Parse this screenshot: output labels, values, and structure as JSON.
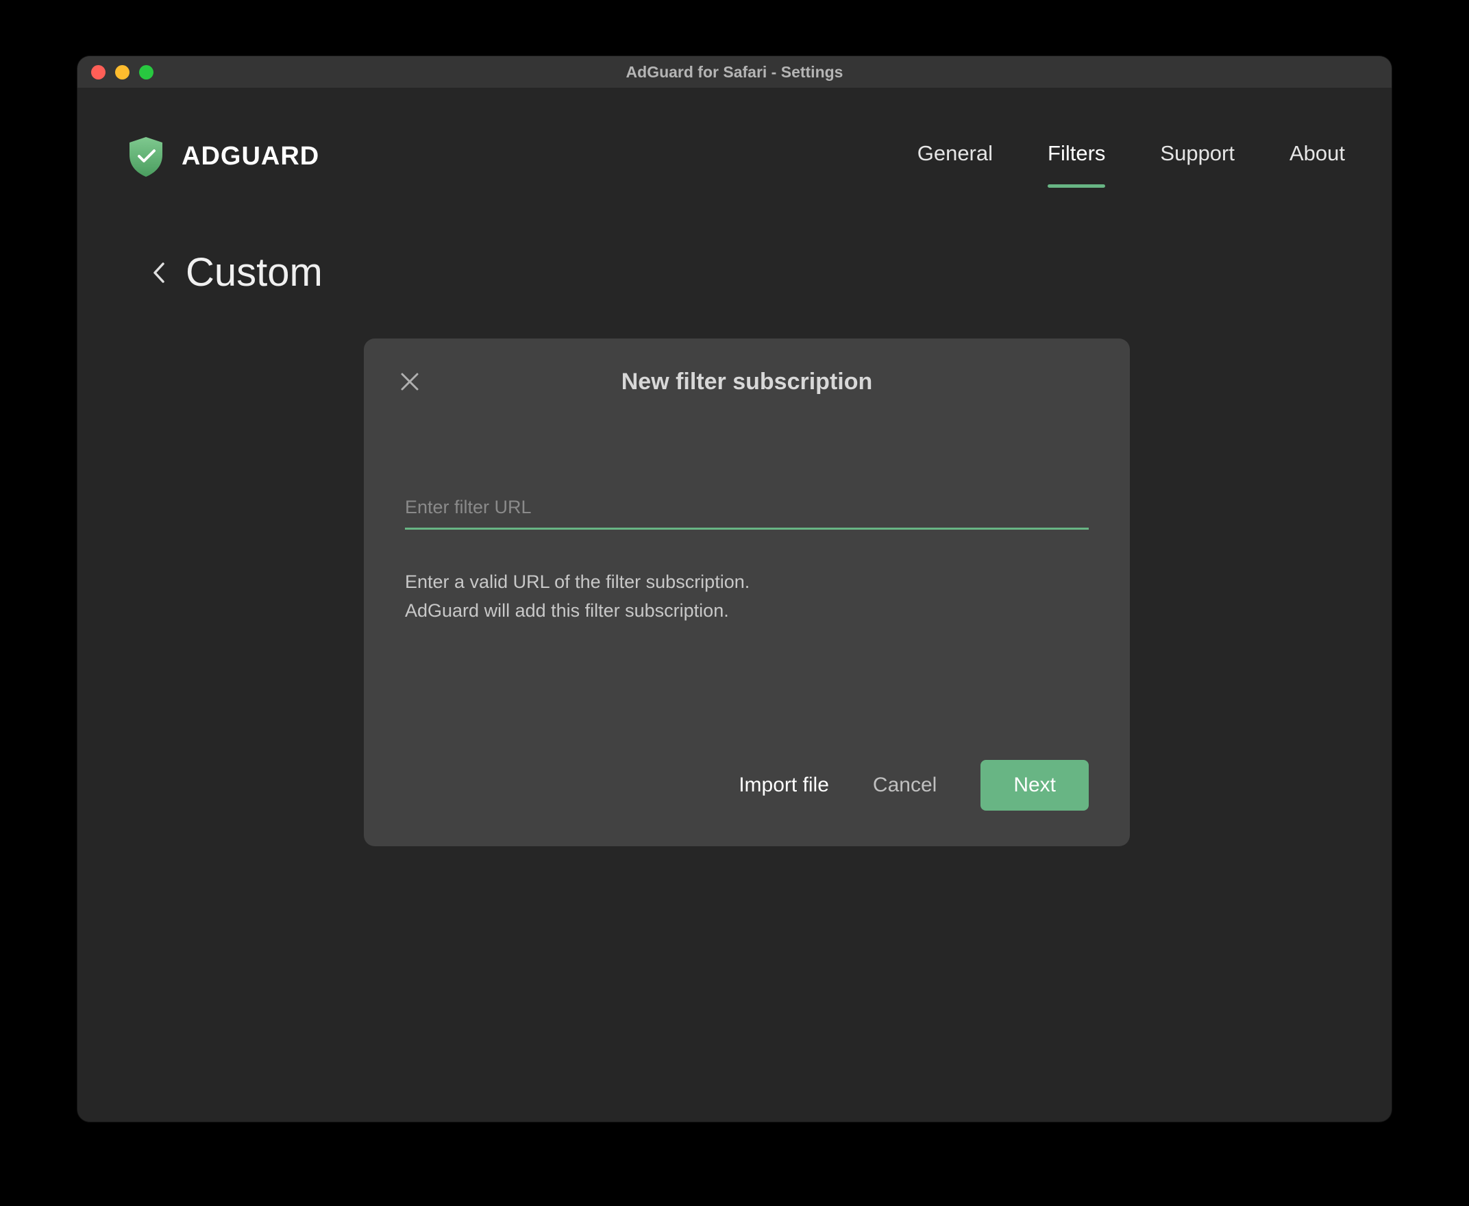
{
  "window": {
    "title": "AdGuard for Safari - Settings"
  },
  "brand": {
    "name": "ADGUARD"
  },
  "nav": {
    "tabs": [
      {
        "label": "General",
        "active": false
      },
      {
        "label": "Filters",
        "active": true
      },
      {
        "label": "Support",
        "active": false
      },
      {
        "label": "About",
        "active": false
      }
    ]
  },
  "page": {
    "title": "Custom"
  },
  "dialog": {
    "title": "New filter subscription",
    "input_placeholder": "Enter filter URL",
    "input_value": "",
    "help_line1": "Enter a valid URL of the filter subscription.",
    "help_line2": "AdGuard will add this filter subscription.",
    "buttons": {
      "import": "Import file",
      "cancel": "Cancel",
      "next": "Next"
    }
  },
  "colors": {
    "accent": "#68b584",
    "bg_window": "#262626",
    "bg_dialog": "#424242"
  }
}
